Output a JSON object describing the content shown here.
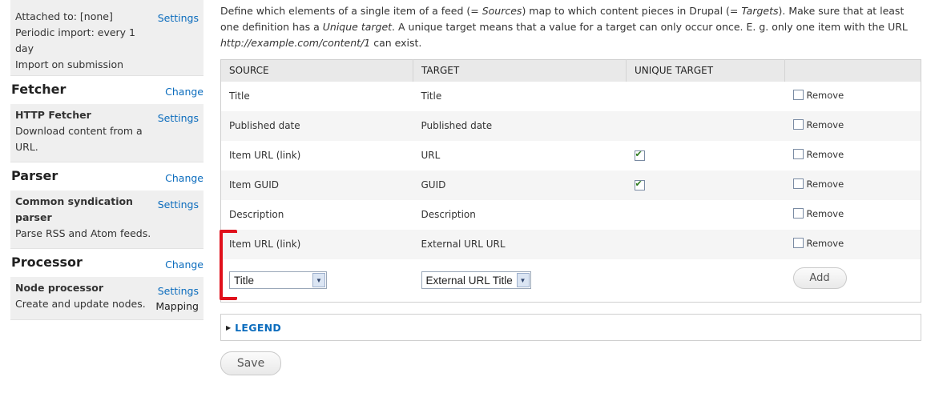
{
  "sidebar": {
    "basic": {
      "lines": [
        "Attached to: [none]",
        "Periodic import: every 1 day",
        "Import on submission"
      ],
      "settings_label": "Settings"
    },
    "fetcher": {
      "heading": "Fetcher",
      "change_label": "Change",
      "name": "HTTP Fetcher",
      "desc": "Download content from a URL.",
      "settings_label": "Settings"
    },
    "parser": {
      "heading": "Parser",
      "change_label": "Change",
      "name": "Common syndication parser",
      "desc": "Parse RSS and Atom feeds.",
      "settings_label": "Settings"
    },
    "processor": {
      "heading": "Processor",
      "change_label": "Change",
      "name": "Node processor",
      "desc": "Create and update nodes.",
      "settings_label": "Settings",
      "mapping_label": "Mapping"
    }
  },
  "description": {
    "part1": "Define which elements of a single item of a feed (= ",
    "sources": "Sources",
    "part2": ") map to which content pieces in Drupal (= ",
    "targets": "Targets",
    "part3": "). Make sure that at least one definition has a ",
    "unique": "Unique target",
    "part4": ". A unique target means that a value for a target can only occur once. E. g. only one item with the URL ",
    "url": "http://example.com/content/1",
    "part5": " can exist."
  },
  "table": {
    "headers": [
      "SOURCE",
      "TARGET",
      "UNIQUE TARGET",
      ""
    ],
    "remove_label": "Remove",
    "rows": [
      {
        "source": "Title",
        "target": "Title",
        "unique": false
      },
      {
        "source": "Published date",
        "target": "Published date",
        "unique": false
      },
      {
        "source": "Item URL (link)",
        "target": "URL",
        "unique": true
      },
      {
        "source": "Item GUID",
        "target": "GUID",
        "unique": true
      },
      {
        "source": "Description",
        "target": "Description",
        "unique": false
      },
      {
        "source": "Item URL (link)",
        "target": "External URL URL",
        "unique": false
      }
    ],
    "add_row": {
      "source_selected": "Title",
      "target_selected": "External URL Title",
      "add_label": "Add"
    }
  },
  "legend": {
    "label": "LEGEND"
  },
  "save_label": "Save",
  "colors": {
    "link": "#0b6cbd",
    "marker": "#e0101b",
    "sidebar_bg": "#efefef"
  }
}
